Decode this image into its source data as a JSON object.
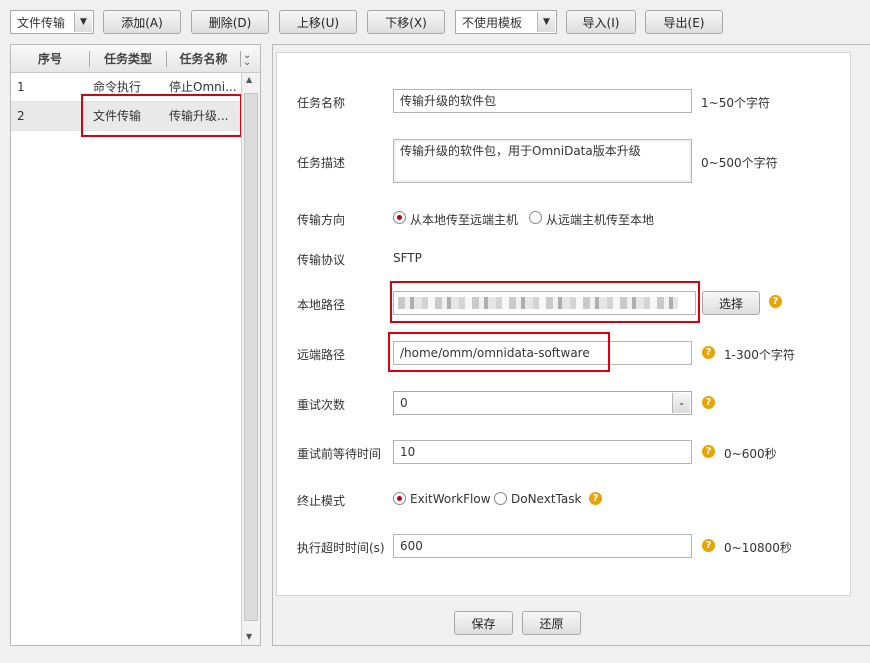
{
  "toolbar": {
    "type_select": "文件传输",
    "add": "添加(A)",
    "delete": "删除(D)",
    "move_up": "上移(U)",
    "move_down": "下移(X)",
    "template_select": "不使用模板",
    "import": "导入(I)",
    "export": "导出(E)"
  },
  "task_table": {
    "headers": [
      "序号",
      "任务类型",
      "任务名称"
    ],
    "rows": [
      {
        "index": "1",
        "type": "命令执行",
        "name": "停止Omni..."
      },
      {
        "index": "2",
        "type": "文件传输",
        "name": "传输升级..."
      }
    ]
  },
  "form": {
    "task_name": {
      "label": "任务名称",
      "value": "传输升级的软件包",
      "hint": "1~50个字符"
    },
    "task_desc": {
      "label": "任务描述",
      "value": "传输升级的软件包，用于OmniData版本升级",
      "hint": "0~500个字符"
    },
    "direction": {
      "label": "传输方向",
      "option1": "从本地传至远端主机",
      "option2": "从远端主机传至本地",
      "selected": "option1"
    },
    "protocol": {
      "label": "传输协议",
      "value": "SFTP"
    },
    "local_path": {
      "label": "本地路径",
      "button": "选择"
    },
    "remote_path": {
      "label": "远端路径",
      "value": "/home/omm/omnidata-software",
      "hint": "1-300个字符"
    },
    "retry_count": {
      "label": "重试次数",
      "value": "0"
    },
    "retry_wait": {
      "label": "重试前等待时间",
      "value": "10",
      "hint": "0~600秒"
    },
    "stop_mode": {
      "label": "终止模式",
      "option1": "ExitWorkFlow",
      "option2": "DoNextTask",
      "selected": "option1"
    },
    "timeout": {
      "label": "执行超时时间(s)",
      "value": "600",
      "hint": "0~10800秒"
    }
  },
  "footer": {
    "save": "保存",
    "restore": "还原"
  },
  "icons": {
    "help": "question-mark-icon"
  },
  "colors": {
    "accent_red": "#d9000f",
    "help_icon": "#e8a400"
  }
}
